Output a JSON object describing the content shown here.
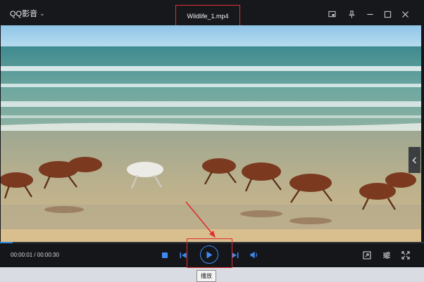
{
  "app": {
    "name": "QQ影音"
  },
  "window": {
    "title": "Wildlife_1.mp4"
  },
  "playback": {
    "current_time": "00:00:01",
    "duration": "00:00:30",
    "time_display": "00:00:01 / 00:00:30",
    "progress": 0.03
  },
  "tooltip": {
    "text": "播放"
  },
  "colors": {
    "accent": "#3d8bf2",
    "highlight_box": "#e03030",
    "background": "#14161a"
  },
  "icons": {
    "titlebar": [
      "screen-icon",
      "pin-icon",
      "minimize-icon",
      "maximize-icon",
      "close-icon"
    ],
    "controls": [
      "stop-icon",
      "previous-icon",
      "play-icon",
      "next-icon",
      "volume-icon",
      "screenshot-icon",
      "settings-icon",
      "fullscreen-icon"
    ]
  }
}
